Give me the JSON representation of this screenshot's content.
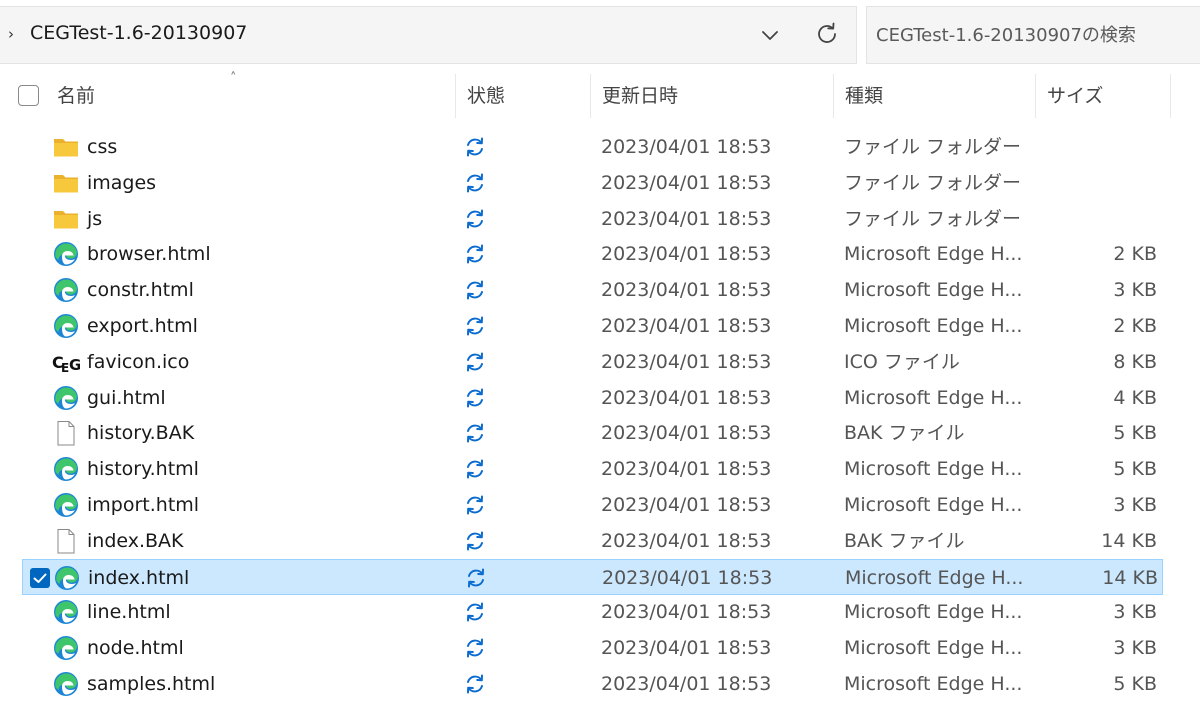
{
  "address": {
    "path": "CEGTest-1.6-20130907",
    "search_placeholder": "CEGTest-1.6-20130907の検索"
  },
  "columns": {
    "name": "名前",
    "status": "状態",
    "modified": "更新日時",
    "type": "種類",
    "size": "サイズ"
  },
  "colors": {
    "accent": "#0067c0",
    "selection": "#cce8ff",
    "folder": "#f8c83c",
    "sync": "#0a6bd0"
  },
  "files": [
    {
      "name": "css",
      "icon": "folder-icon",
      "date": "2023/04/01 18:53",
      "type": "ファイル フォルダー",
      "size": ""
    },
    {
      "name": "images",
      "icon": "folder-icon",
      "date": "2023/04/01 18:53",
      "type": "ファイル フォルダー",
      "size": ""
    },
    {
      "name": "js",
      "icon": "folder-icon",
      "date": "2023/04/01 18:53",
      "type": "ファイル フォルダー",
      "size": ""
    },
    {
      "name": "browser.html",
      "icon": "edge-icon",
      "date": "2023/04/01 18:53",
      "type": "Microsoft Edge H...",
      "size": "2 KB"
    },
    {
      "name": "constr.html",
      "icon": "edge-icon",
      "date": "2023/04/01 18:53",
      "type": "Microsoft Edge H...",
      "size": "3 KB"
    },
    {
      "name": "export.html",
      "icon": "edge-icon",
      "date": "2023/04/01 18:53",
      "type": "Microsoft Edge H...",
      "size": "2 KB"
    },
    {
      "name": "favicon.ico",
      "icon": "ceg-icon",
      "date": "2023/04/01 18:53",
      "type": "ICO ファイル",
      "size": "8 KB"
    },
    {
      "name": "gui.html",
      "icon": "edge-icon",
      "date": "2023/04/01 18:53",
      "type": "Microsoft Edge H...",
      "size": "4 KB"
    },
    {
      "name": "history.BAK",
      "icon": "file-icon",
      "date": "2023/04/01 18:53",
      "type": "BAK ファイル",
      "size": "5 KB"
    },
    {
      "name": "history.html",
      "icon": "edge-icon",
      "date": "2023/04/01 18:53",
      "type": "Microsoft Edge H...",
      "size": "5 KB"
    },
    {
      "name": "import.html",
      "icon": "edge-icon",
      "date": "2023/04/01 18:53",
      "type": "Microsoft Edge H...",
      "size": "3 KB"
    },
    {
      "name": "index.BAK",
      "icon": "file-icon",
      "date": "2023/04/01 18:53",
      "type": "BAK ファイル",
      "size": "14 KB"
    },
    {
      "name": "index.html",
      "icon": "edge-icon",
      "date": "2023/04/01 18:53",
      "type": "Microsoft Edge H...",
      "size": "14 KB",
      "selected": true
    },
    {
      "name": "line.html",
      "icon": "edge-icon",
      "date": "2023/04/01 18:53",
      "type": "Microsoft Edge H...",
      "size": "3 KB"
    },
    {
      "name": "node.html",
      "icon": "edge-icon",
      "date": "2023/04/01 18:53",
      "type": "Microsoft Edge H...",
      "size": "3 KB"
    },
    {
      "name": "samples.html",
      "icon": "edge-icon",
      "date": "2023/04/01 18:53",
      "type": "Microsoft Edge H...",
      "size": "5 KB"
    }
  ]
}
